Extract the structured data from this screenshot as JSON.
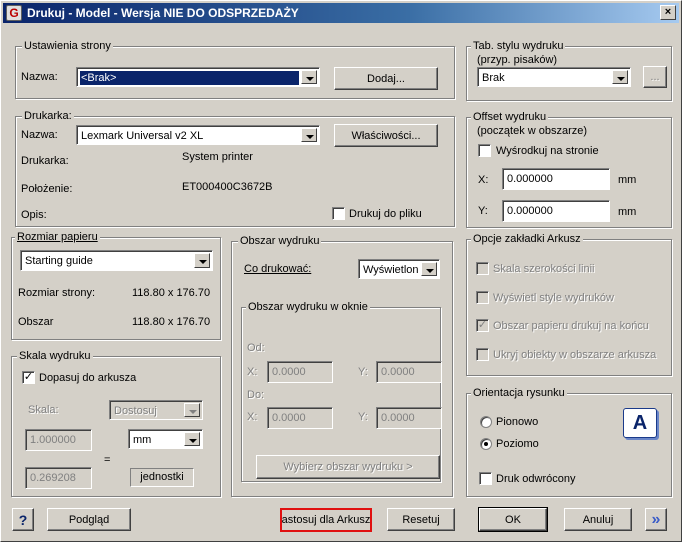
{
  "window": {
    "title": "Drukuj - Model - Wersja NIE DO ODSPRZEDAŻY",
    "close": "×",
    "app_icon": "G"
  },
  "page_setup": {
    "title": "Ustawienia strony",
    "name_label": "Nazwa:",
    "name_value": "<Brak>",
    "add_button": "Dodaj..."
  },
  "printer": {
    "title": "Drukarka:",
    "name_label": "Nazwa:",
    "name_value": "Lexmark Universal v2 XL",
    "properties_button": "Właściwości...",
    "printer_label": "Drukarka:",
    "printer_value": "System printer",
    "location_label": "Położenie:",
    "location_value": "ET000400C3672B",
    "description_label": "Opis:",
    "print_to_file": "Drukuj do pliku",
    "print_to_file_checked": false
  },
  "paper_size": {
    "title": "Rozmiar papieru",
    "value": "Starting guide",
    "page_size_label": "Rozmiar strony:",
    "page_size_value": "118.80 x 176.70",
    "area_label": "Obszar",
    "area_value": "118.80 x 176.70"
  },
  "print_area": {
    "title": "Obszar wydruku",
    "what_label": "Co drukować:",
    "what_value": "Wyświetlone",
    "window_group_title": "Obszar wydruku w oknie",
    "from_label": "Od:",
    "to_label": "Do:",
    "x_label": "X:",
    "y_label": "Y:",
    "from_x": "0.0000",
    "from_y": "0.0000",
    "to_x": "0.0000",
    "to_y": "0.0000",
    "select_button": "Wybierz obszar wydruku >"
  },
  "plot_scale": {
    "title": "Skala wydruku",
    "fit": "Dopasuj do arkusza",
    "fit_checked": true,
    "scale_label": "Skala:",
    "scale_value": "Dostosuj",
    "value1": "1.000000",
    "units_value": "mm",
    "equals": "=",
    "value2": "0.269208",
    "units_label": "jednostki"
  },
  "plot_style": {
    "title": "Tab. stylu wydruku",
    "subtitle": "(przyp. pisaków)",
    "value": "Brak",
    "edit_button": "..."
  },
  "plot_offset": {
    "title": "Offset wydruku",
    "subtitle": "(początek w obszarze)",
    "center": "Wyśrodkuj na stronie",
    "center_checked": false,
    "x_label": "X:",
    "x_value": "0.000000",
    "x_unit": "mm",
    "y_label": "Y:",
    "y_value": "0.000000",
    "y_unit": "mm"
  },
  "sheet_options": {
    "title": "Opcje zakładki Arkusz",
    "opt1": "Skala szerokości linii",
    "opt1_checked": false,
    "opt2": "Wyświetl style wydruków",
    "opt2_checked": false,
    "opt3": "Obszar papieru drukuj na końcu",
    "opt3_checked": true,
    "opt4": "Ukryj obiekty w obszarze arkusza",
    "opt4_checked": false
  },
  "orientation": {
    "title": "Orientacja rysunku",
    "portrait": "Pionowo",
    "landscape": "Poziomo",
    "selected": "landscape",
    "reverse": "Druk odwrócony",
    "reverse_checked": false,
    "preview_letter": "A"
  },
  "footer": {
    "help": "?",
    "preview": "Podgląd",
    "apply": "astosuj dla Arkusz",
    "apply_highlight": "#e01010",
    "reset": "Resetuj",
    "ok": "OK",
    "cancel": "Anuluj",
    "more": "»"
  },
  "colors": {
    "dialog_bg": "#d4d0c8",
    "title_start": "#0a246a",
    "title_end": "#a6caf0",
    "selection": "#0a246a"
  }
}
